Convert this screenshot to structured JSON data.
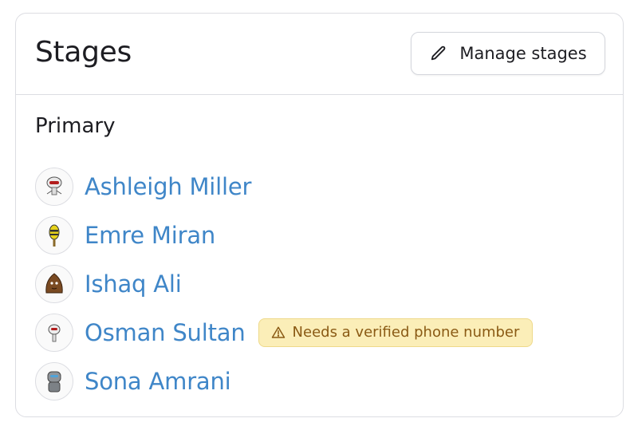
{
  "card": {
    "title": "Stages",
    "manage_button": {
      "label": "Manage stages",
      "icon": "pencil-icon"
    }
  },
  "section": {
    "title": "Primary",
    "people": [
      {
        "name": "Ashleigh Miller",
        "avatar": "robot-avatar-red-eye"
      },
      {
        "name": "Emre Miran",
        "avatar": "yellow-bee-avatar"
      },
      {
        "name": "Ishaq Ali",
        "avatar": "brown-creature-avatar"
      },
      {
        "name": "Osman Sultan",
        "avatar": "robot-avatar-small",
        "warning": "Needs a verified phone number"
      },
      {
        "name": "Sona Amrani",
        "avatar": "grey-robot-avatar"
      }
    ]
  },
  "colors": {
    "link": "#3f86c8",
    "warning_bg": "#fbeeb8",
    "warning_border": "#eed98a",
    "warning_text": "#8a5a14",
    "border": "#dcdde2"
  }
}
